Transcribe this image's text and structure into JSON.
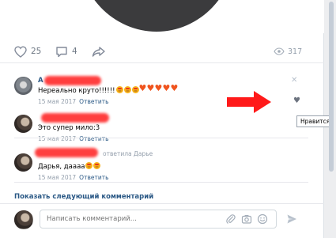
{
  "post": {
    "likes_count": "25",
    "comments_count": "4",
    "views_count": "317"
  },
  "comments": [
    {
      "author": "А",
      "text": "Нереально круто!!!!!!",
      "date": "15 мая 2017",
      "reply_label": "Ответить"
    },
    {
      "text": "Это супер мило:3",
      "date": "15 мая 2017",
      "reply_label": "Ответить"
    },
    {
      "replied_to": "ответила Дарье",
      "text": "Дарья, даааа",
      "date": "15 мая 2017",
      "reply_label": "Ответить"
    }
  ],
  "tooltip": "Нравится",
  "show_next_label": "Показать следующий комментарий",
  "composer": {
    "placeholder": "Написать комментарий..."
  },
  "colors": {
    "link": "#2a5885",
    "muted": "#939eab",
    "annotation": "#ff2a2a"
  },
  "icons": {
    "like": "heart-outline-icon",
    "comment": "speech-bubble-icon",
    "share": "share-arrow-icon",
    "views": "eye-icon",
    "close": "close-icon",
    "attach": "paperclip-icon",
    "camera": "camera-icon",
    "emoji": "smile-icon",
    "send": "send-icon"
  }
}
